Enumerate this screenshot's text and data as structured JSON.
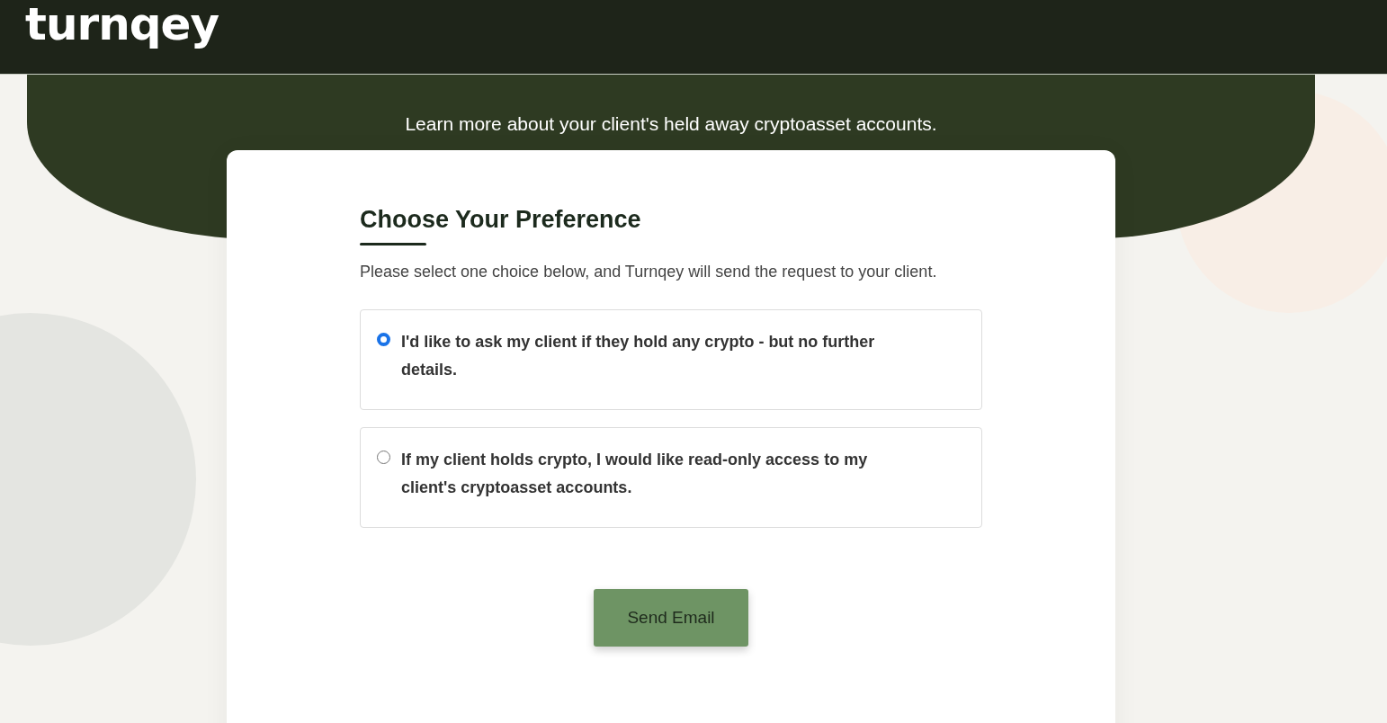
{
  "header": {
    "logo": "turnqey"
  },
  "banner": {
    "text": "Learn more about your client's held away cryptoasset accounts."
  },
  "card": {
    "title": "Choose Your Preference",
    "description": "Please select one choice below, and Turnqey will send the request to your client.",
    "options": [
      {
        "label": "I'd like to ask my client if they hold any crypto - but no further details.",
        "selected": true
      },
      {
        "label": "If my client holds crypto, I would like read-only access to my client's cryptoasset accounts.",
        "selected": false
      }
    ],
    "button": "Send Email"
  }
}
